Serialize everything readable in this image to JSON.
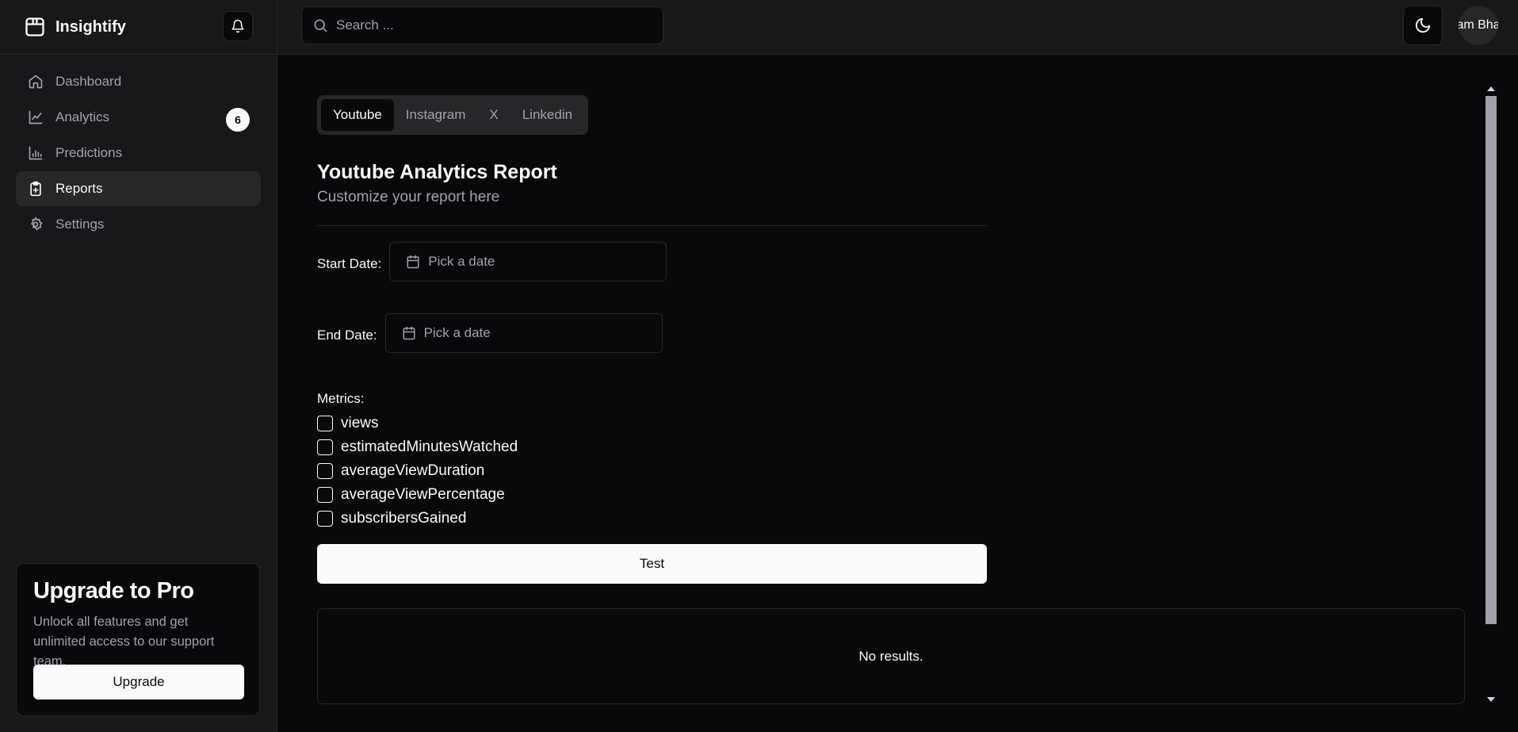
{
  "brand": {
    "name": "Insightify"
  },
  "sidebar": {
    "items": [
      {
        "label": "Dashboard",
        "icon": "home-icon"
      },
      {
        "label": "Analytics",
        "icon": "line-chart-icon",
        "badge": "6"
      },
      {
        "label": "Predictions",
        "icon": "bar-chart-icon"
      },
      {
        "label": "Reports",
        "icon": "clipboard-icon",
        "active": true
      },
      {
        "label": "Settings",
        "icon": "gear-icon"
      }
    ]
  },
  "upgrade": {
    "title": "Upgrade to Pro",
    "text": "Unlock all features and get unlimited access to our support team.",
    "button": "Upgrade"
  },
  "header": {
    "search_placeholder": "Search ...",
    "user_name": "am Bha"
  },
  "tabs": [
    "Youtube",
    "Instagram",
    "X",
    "Linkedin"
  ],
  "report": {
    "title": "Youtube Analytics Report",
    "subtitle": "Customize your report here",
    "start_label": "Start Date:",
    "end_label": "End Date:",
    "date_placeholder": "Pick a date",
    "metrics_label": "Metrics:",
    "metrics": [
      "views",
      "estimatedMinutesWatched",
      "averageViewDuration",
      "averageViewPercentage",
      "subscribersGained"
    ],
    "test_button": "Test",
    "results_text": "No results."
  },
  "colors": {
    "background": "#09090b",
    "surface": "#18181b",
    "border": "#27272a",
    "foreground": "#fafafa",
    "muted": "#a1a1aa"
  }
}
